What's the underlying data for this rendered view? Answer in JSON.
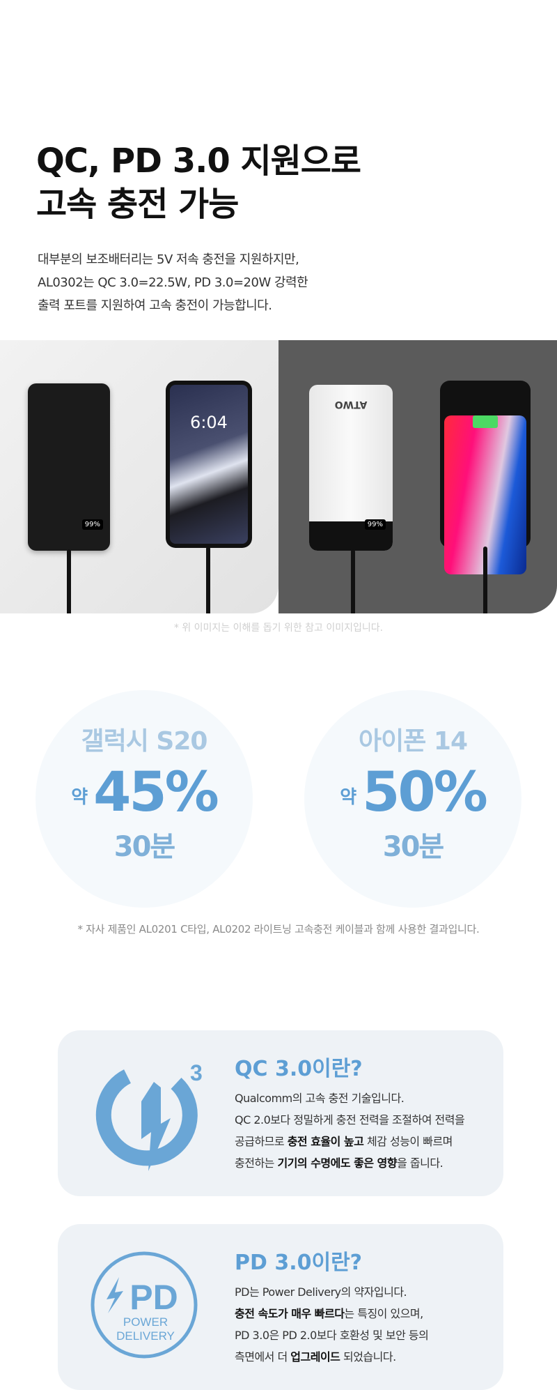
{
  "heading": {
    "line1": "QC, PD 3.0 지원으로",
    "line2": "고속 충전 가능"
  },
  "description": [
    "대부분의 보조배터리는 5V 저속 충전을 지원하지만,",
    "AL0302는 QC 3.0=22.5W, PD 3.0=20W 강력한",
    "출력 포트를 지원하여 고속 충전이 가능합니다."
  ],
  "photos": {
    "left_clock": "6:04",
    "bank_display": "99%",
    "brand": "ATWO",
    "caption": "* 위 이미지는 이해를 돕기 위한 참고 이미지입니다."
  },
  "results": [
    {
      "device": "갤럭시 S20",
      "prefix": "약",
      "percent": "45%",
      "time": "30분"
    },
    {
      "device": "아이폰 14",
      "prefix": "약",
      "percent": "50%",
      "time": "30분"
    }
  ],
  "results_note": "* 자사 제품인 AL0201 C타입, AL0202 라이트닝 고속충전 케이블과 함께 사용한 결과입니다.",
  "qc": {
    "icon": "quick-charge-3-icon",
    "icon_number": "3",
    "title": "QC 3.0이란?",
    "l1": "Qualcomm의 고속 충전 기술입니다.",
    "l2": "QC 2.0보다 정밀하게 충전 전력을 조절하여 전력을",
    "l3a": "공급하므로 ",
    "l3b": "충전 효율이 높고",
    "l3c": " 체감 성능이 빠르며",
    "l4a": "충전하는 ",
    "l4b": "기기의 수명에도 좋은 영향",
    "l4c": "을 줍니다."
  },
  "pd": {
    "icon": "power-delivery-icon",
    "logo_pd": "PD",
    "logo_l1": "POWER",
    "logo_l2": "DELIVERY",
    "title": "PD 3.0이란?",
    "l1": "PD는 Power Delivery의 약자입니다.",
    "l2a": "충전 속도가 매우 빠르다",
    "l2b": "는 특징이 있으며,",
    "l3": "PD 3.0은 PD 2.0보다 호환성 및 보안 등의",
    "l4a": "측면에서 더 ",
    "l4b": "업그레이드",
    "l4c": " 되었습니다."
  },
  "colors": {
    "accent": "#5d9ed4",
    "light_accent": "#a9c8e2",
    "box_bg": "#eef2f6"
  }
}
